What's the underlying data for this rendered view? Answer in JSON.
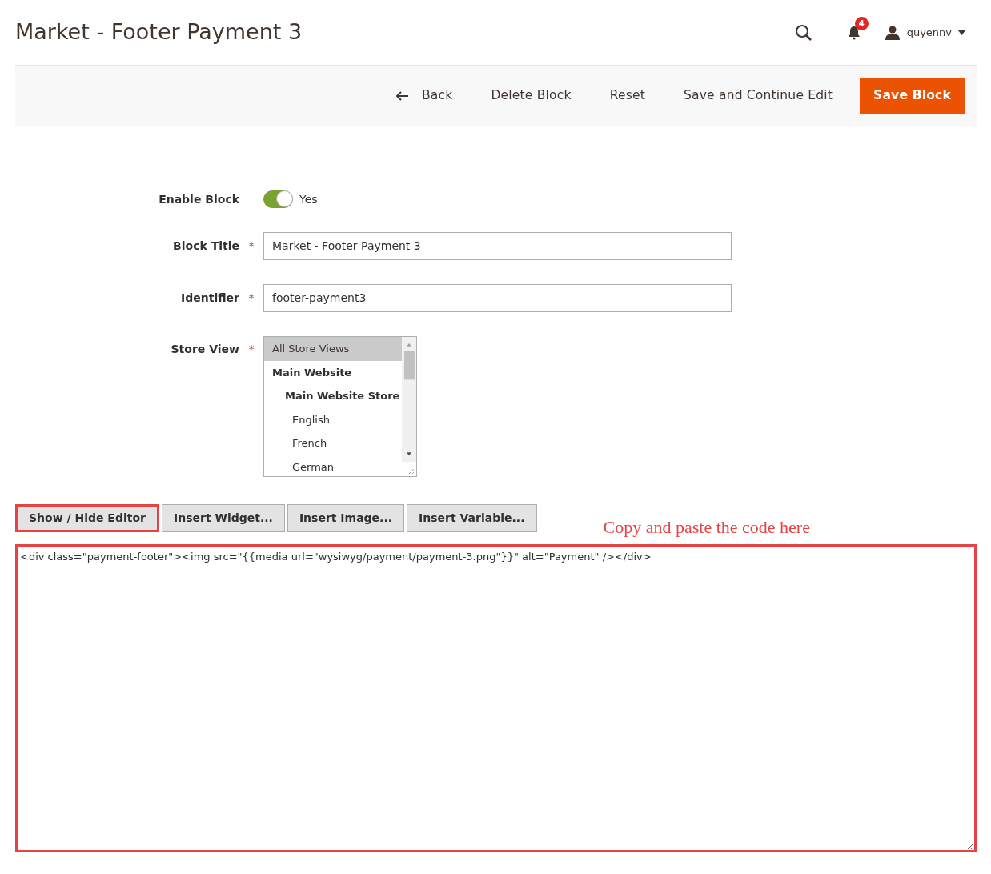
{
  "header": {
    "title": "Market - Footer Payment 3",
    "notification_count": "4",
    "user": "quyennv"
  },
  "actions": [
    {
      "label": "Back",
      "kind": "back"
    },
    {
      "label": "Delete Block",
      "kind": "plain"
    },
    {
      "label": "Reset",
      "kind": "plain"
    },
    {
      "label": "Save and Continue Edit",
      "kind": "plain"
    },
    {
      "label": "Save Block",
      "kind": "primary"
    }
  ],
  "enable_block": {
    "label": "Enable Block",
    "on": true,
    "value": "Yes"
  },
  "fields": [
    {
      "label": "Block Title",
      "required_mark": "*",
      "value": "Market - Footer Payment 3"
    },
    {
      "label": "Identifier",
      "required_mark": "*",
      "value": "footer-payment3"
    }
  ],
  "store_view": {
    "label": "Store View",
    "required_mark": "*",
    "options": [
      {
        "label": "All Store Views",
        "selected": true
      },
      {
        "label": "Main Website",
        "selected": false,
        "children": [
          {
            "label": "Main Website Store",
            "selected": false,
            "children": [
              {
                "label": "English",
                "selected": false
              },
              {
                "label": "French",
                "selected": false
              },
              {
                "label": "German",
                "selected": false
              }
            ]
          }
        ]
      }
    ]
  },
  "editor_buttons": [
    {
      "label": "Show / Hide Editor",
      "highlighted": true
    },
    {
      "label": "Insert Widget...",
      "highlighted": false
    },
    {
      "label": "Insert Image...",
      "highlighted": false
    },
    {
      "label": "Insert Variable...",
      "highlighted": false
    }
  ],
  "annotation": "Copy and paste the code here",
  "editor": {
    "value": "<div class=\"payment-footer\"><img src=\"{{media url=\"wysiwyg/payment/payment-3.png\"}}\" alt=\"Payment\" /></div>",
    "highlighted": true
  }
}
